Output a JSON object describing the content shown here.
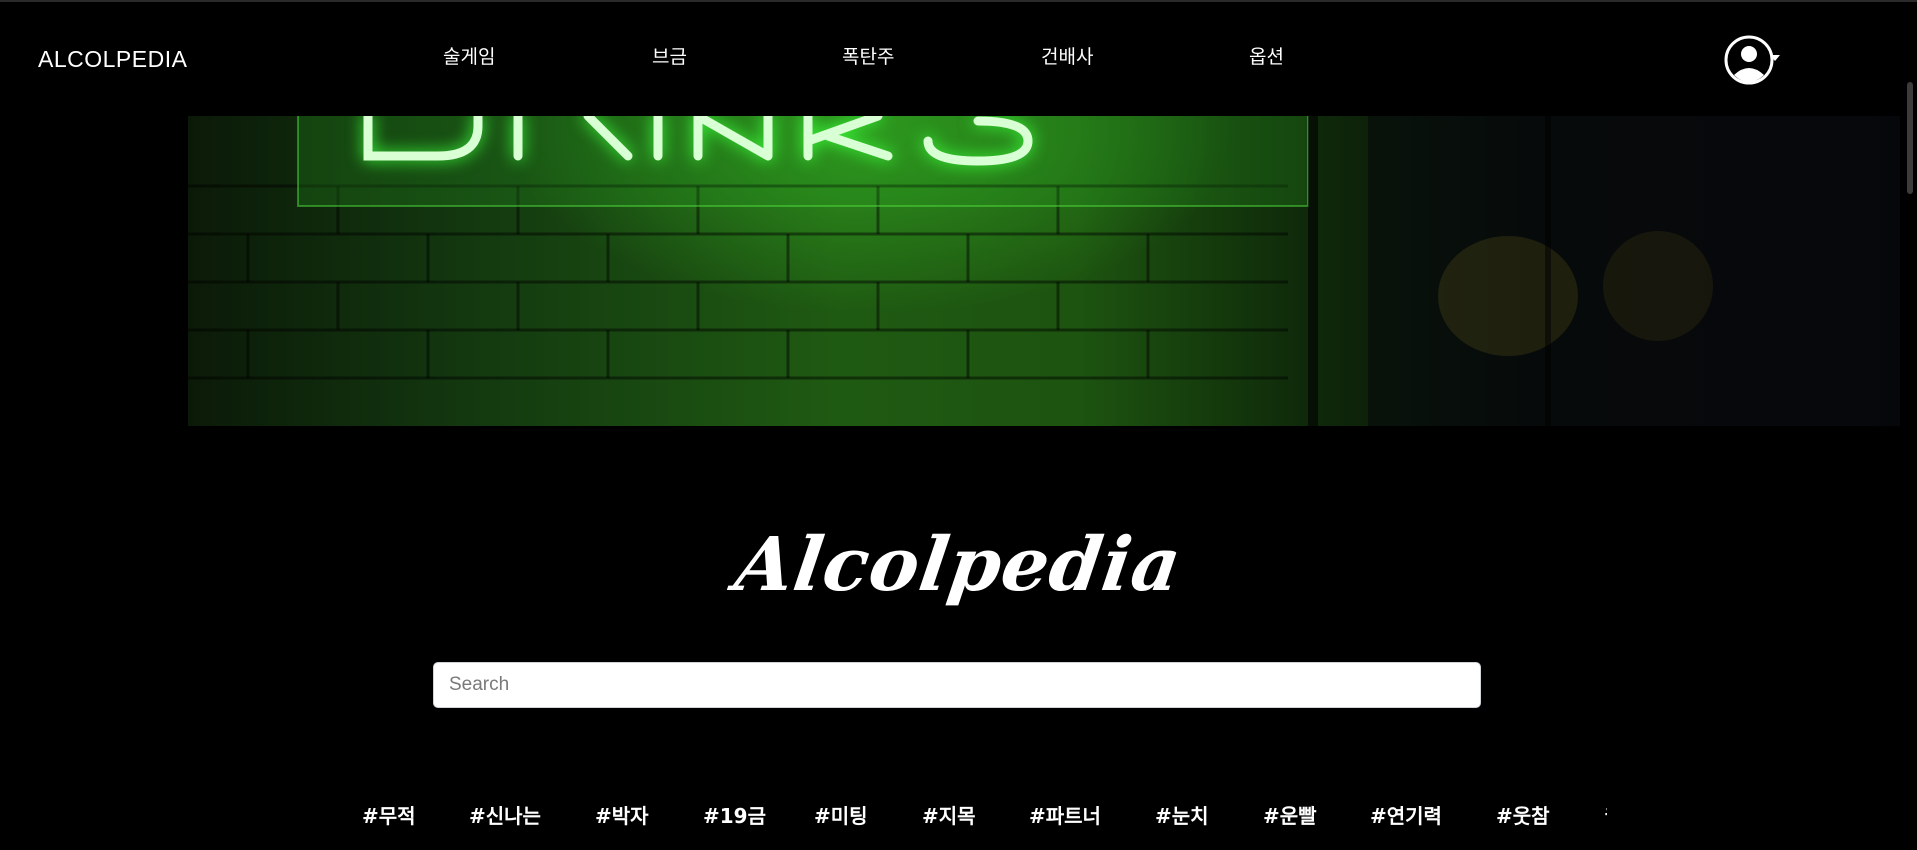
{
  "navbar": {
    "brand": "ALCOLPEDIA",
    "items": [
      {
        "label": "술게임"
      },
      {
        "label": "브금"
      },
      {
        "label": "폭탄주"
      },
      {
        "label": "건배사"
      },
      {
        "label": "옵션"
      }
    ],
    "user_menu": {
      "icon": "user-circle-icon",
      "caret_icon": "caret-down-icon"
    }
  },
  "hero": {
    "image": "neon-drinks-sign-on-brick-wall",
    "accent_color": "#2cff3a"
  },
  "title": "Alcolpedia",
  "search": {
    "placeholder": "Search",
    "value": ""
  },
  "tags": [
    "#무적",
    "#신나는",
    "#박자",
    "#19금",
    "#미팅",
    "#지목",
    "#파트너",
    "#눈치",
    "#운빨",
    "#연기력",
    "#웃참",
    "#"
  ],
  "colors": {
    "background": "#000000",
    "text": "#ffffff"
  }
}
